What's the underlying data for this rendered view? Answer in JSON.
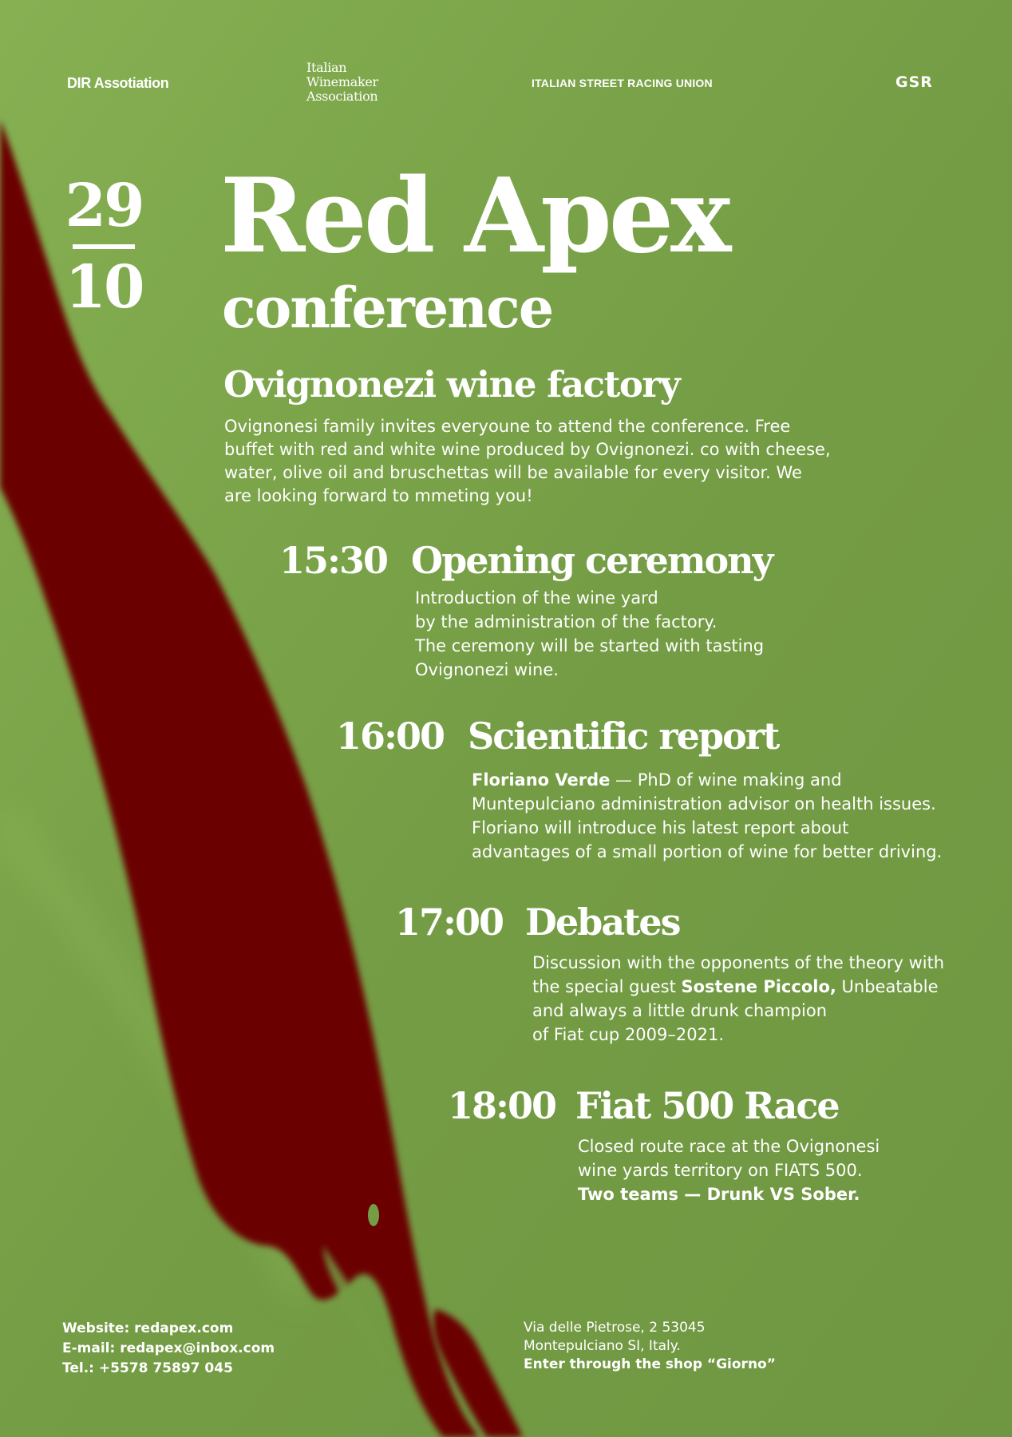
{
  "colors": {
    "background": "#759d45",
    "wine_red": "#6a0306",
    "text": "#ffffff"
  },
  "header": {
    "org_1": "DIR Assotiation",
    "org_2_lines": [
      "Italian",
      "Winemaker",
      "Association"
    ],
    "org_3": "ITALIAN STREET RACING UNION",
    "org_4": "GSR"
  },
  "date": {
    "day": "29",
    "month": "10"
  },
  "title": "Red Apex",
  "subtitle": "conference",
  "venue": {
    "title": "Ovignonezi wine  factory",
    "description": "Ovignonesi family invites everyoune to attend the conference. Free buffet with red and white wine produced by Ovignonezi. co with cheese, water, olive oil and bruschettas will be available for every visitor. We are looking forward to mmeting you!"
  },
  "schedule": [
    {
      "time": "15:30",
      "name": "Opening ceremony",
      "lines": [
        "Introduction of the wine yard",
        "by the administration of the factory.",
        "The ceremony will be started with tasting",
        "Ovignonezi wine."
      ]
    },
    {
      "time": "16:00",
      "name": "Scientific report",
      "speaker": "Floriano Verde",
      "line_1_rest": " — PhD of wine making and",
      "lines": [
        "Muntepulciano administration advisor on health issues.",
        "Floriano will introduce his latest report about",
        "advantages of a small portion of wine for better driving."
      ]
    },
    {
      "time": "17:00",
      "name": "Debates",
      "line_1": "Discussion with the opponents of the theory with",
      "line_2_start": "the special guest ",
      "guest": "Sostene Piccolo,",
      "line_2_end": " Unbeatable",
      "lines": [
        "and always a little drunk champion",
        "of Fiat cup 2009–2021."
      ]
    },
    {
      "time": "18:00",
      "name": "Fiat 500 Race",
      "lines": [
        "Closed route race at the Ovignonesi",
        "wine yards territory on FIATS 500."
      ],
      "emphasis": "Two teams — Drunk VS Sober."
    }
  ],
  "contacts": {
    "website": "Website: redapex.com",
    "email": "E-mail: redapex@inbox.com",
    "phone": "Tel.: +5578 75897 045"
  },
  "address": {
    "line_1": "Via delle Pietrose, 2 53045",
    "line_2": "Montepulciano SI, Italy.",
    "line_3": "Enter through the shop “Giorno”"
  }
}
